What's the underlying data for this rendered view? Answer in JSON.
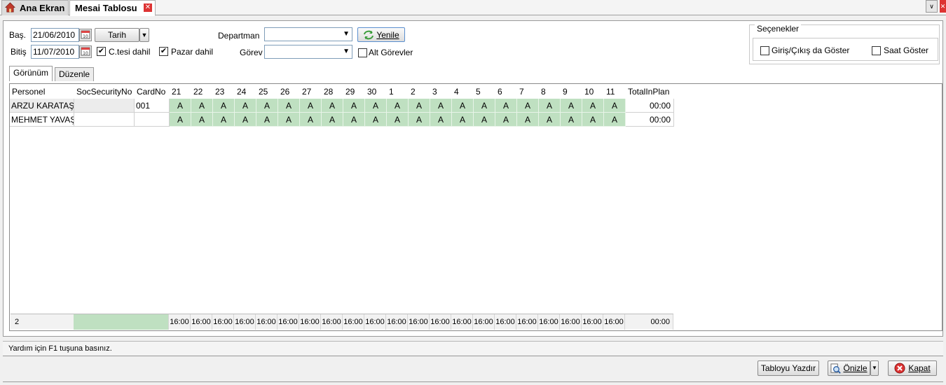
{
  "tabs": {
    "home_label": "Ana Ekran",
    "active_label": "Mesai Tablosu",
    "close_symbol": "✕",
    "dropdown_symbol": "∨"
  },
  "filters": {
    "start_label": "Baş.",
    "start_date": "21/06/2010",
    "end_label": "Bitiş",
    "end_date": "11/07/2010",
    "mode_label": "Tarih",
    "saturday_label": "C.tesi dahil",
    "saturday_checked": true,
    "sunday_label": "Pazar dahil",
    "sunday_checked": true,
    "department_label": "Departman",
    "department_value": "",
    "role_label": "Görev",
    "role_value": "",
    "refresh_label": "Yenile",
    "subroles_label": "Alt Görevler",
    "subroles_checked": false,
    "check_mark": "✔"
  },
  "options": {
    "legend": "Seçenekler",
    "show_inout_label": "Giriş/Çıkış da Göster",
    "show_hours_label": "Saat Göster"
  },
  "view_tabs": [
    "Görünüm",
    "Düzenle"
  ],
  "grid": {
    "headers": [
      "Personel",
      "SocSecurityNo",
      "CardNo",
      "21",
      "22",
      "23",
      "24",
      "25",
      "26",
      "27",
      "28",
      "29",
      "30",
      "1",
      "2",
      "3",
      "4",
      "5",
      "6",
      "7",
      "8",
      "9",
      "10",
      "11",
      "TotalInPlan"
    ],
    "rows": [
      {
        "personel": "ARZU KARATAŞ",
        "ssn": "",
        "card": "001",
        "day_value": "A",
        "total": "00:00"
      },
      {
        "personel": "MEHMET YAVAŞ",
        "ssn": "",
        "card": "",
        "day_value": "A",
        "total": "00:00"
      }
    ],
    "footer": {
      "count": "2",
      "day_total": "16:00",
      "grand_total": "00:00"
    }
  },
  "status_text": "Yardım için F1 tuşuna basınız.",
  "buttons": {
    "print_label": "Tabloyu Yazdır",
    "preview_label": "Önizle",
    "close_label": "Kapat"
  },
  "colors": {
    "assigned_cell": "#bfe0c1",
    "close_red": "#dd3333"
  }
}
